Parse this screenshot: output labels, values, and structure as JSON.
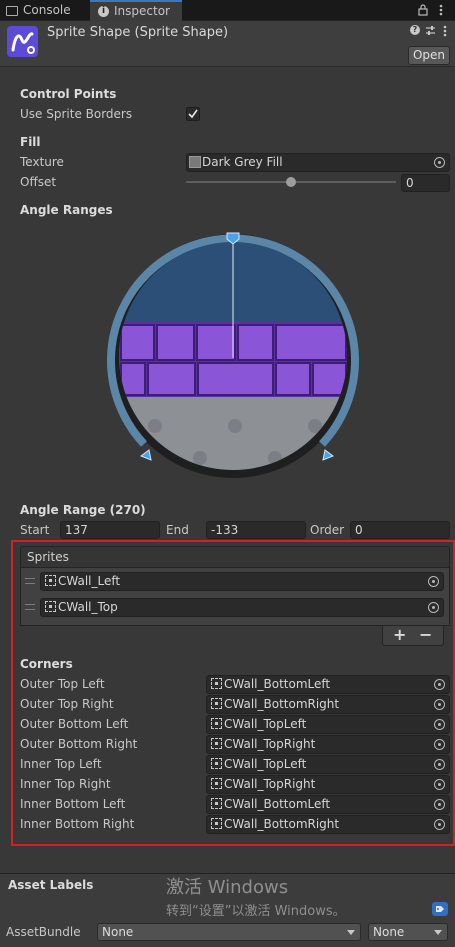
{
  "tabs": [
    {
      "label": "Console",
      "icon": "console-icon"
    },
    {
      "label": "Inspector",
      "icon": "info-icon"
    }
  ],
  "header": {
    "title": "Sprite Shape (Sprite Shape)",
    "open_label": "Open"
  },
  "control_points": {
    "heading": "Control Points",
    "use_sprite_borders_label": "Use Sprite Borders",
    "use_sprite_borders": true
  },
  "fill": {
    "heading": "Fill",
    "texture_label": "Texture",
    "texture_value": "Dark Grey Fill",
    "offset_label": "Offset",
    "offset_value": "0",
    "offset_slider_fraction": 0.5
  },
  "angle_ranges": {
    "heading": "Angle Ranges"
  },
  "angle_range": {
    "heading": "Angle Range (270)",
    "start_label": "Start",
    "start_value": "137",
    "end_label": "End",
    "end_value": "-133",
    "order_label": "Order",
    "order_value": "0"
  },
  "sprites": {
    "heading": "Sprites",
    "items": [
      "CWall_Left",
      "CWall_Top"
    ],
    "add": "+",
    "remove": "−"
  },
  "corners": {
    "heading": "Corners",
    "items": [
      {
        "label": "Outer Top Left",
        "value": "CWall_BottomLeft"
      },
      {
        "label": "Outer Top Right",
        "value": "CWall_BottomRight"
      },
      {
        "label": "Outer Bottom Left",
        "value": "CWall_TopLeft"
      },
      {
        "label": "Outer Bottom Right",
        "value": "CWall_TopRight"
      },
      {
        "label": "Inner Top Left",
        "value": "CWall_TopLeft"
      },
      {
        "label": "Inner Top Right",
        "value": "CWall_TopRight"
      },
      {
        "label": "Inner Bottom Left",
        "value": "CWall_BottomLeft"
      },
      {
        "label": "Inner Bottom Right",
        "value": "CWall_BottomRight"
      }
    ]
  },
  "footer": {
    "asset_labels": "Asset Labels",
    "asset_bundle_label": "AssetBundle",
    "bundle_value": "None",
    "variant_value": "None"
  },
  "watermark": {
    "line1": "激活 Windows",
    "line2": "转到“设置”以激活 Windows。"
  },
  "colors": {
    "accent_blue": "#3a79bb",
    "highlight_red": "#d42020",
    "wall_purple": "#7b3fc4"
  }
}
